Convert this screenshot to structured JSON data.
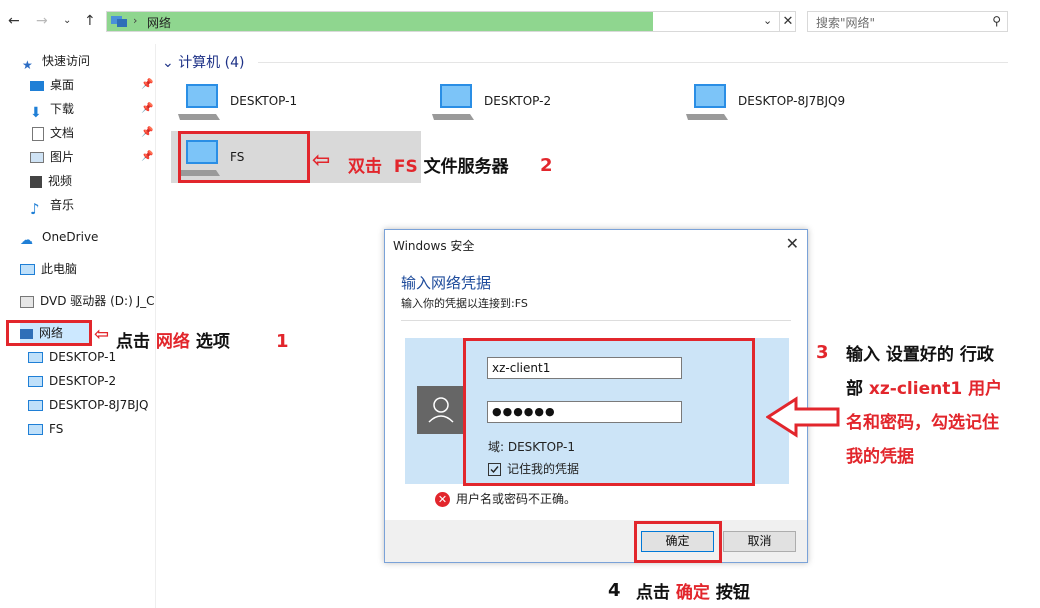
{
  "address_bar": {
    "path": "网络",
    "search_placeholder": "搜索\"网络\""
  },
  "sidebar": {
    "items": [
      {
        "label": "快速访问"
      },
      {
        "label": "桌面"
      },
      {
        "label": "下载"
      },
      {
        "label": "文档"
      },
      {
        "label": "图片"
      },
      {
        "label": "视频"
      },
      {
        "label": "音乐"
      },
      {
        "label": "OneDrive"
      },
      {
        "label": "此电脑"
      },
      {
        "label": "DVD 驱动器 (D:) J_C"
      },
      {
        "label": "网络"
      },
      {
        "label": "DESKTOP-1"
      },
      {
        "label": "DESKTOP-2"
      },
      {
        "label": "DESKTOP-8J7BJQ"
      },
      {
        "label": "FS"
      }
    ]
  },
  "content": {
    "group_label": "计算机 (4)",
    "computers": [
      {
        "label": "DESKTOP-1"
      },
      {
        "label": "DESKTOP-2"
      },
      {
        "label": "DESKTOP-8J7BJQ9"
      },
      {
        "label": "FS"
      }
    ]
  },
  "annotations": {
    "step1": {
      "a": "点击",
      "b": "网络",
      "c": "选项",
      "num": "1"
    },
    "step2": {
      "a": "双击",
      "b": "FS",
      "c": "文件服务器",
      "num": "2"
    },
    "step3": {
      "num": "3",
      "l1a": "输入 设置好的 行政",
      "l2a": "部",
      "l2b": "xz-client1",
      "l2c": "用户",
      "l3": "名和密码，勾选记住",
      "l4": "我的凭据"
    },
    "step4": {
      "num": "4",
      "a": "点击",
      "b": "确定",
      "c": "按钮"
    }
  },
  "dialog": {
    "title": "Windows 安全",
    "heading": "输入网络凭据",
    "subheading": "输入你的凭据以连接到:FS",
    "username": "xz-client1",
    "password": "●●●●●●",
    "domain": "域: DESKTOP-1",
    "remember_label": "记住我的凭据",
    "error": "用户名或密码不正确。",
    "ok_label": "确定",
    "cancel_label": "取消"
  },
  "colors": {
    "annotation_red": "#e2262c",
    "address_progress": "#8fd68f",
    "credential_bg": "#cce4f7",
    "link_blue": "#1e3287"
  }
}
